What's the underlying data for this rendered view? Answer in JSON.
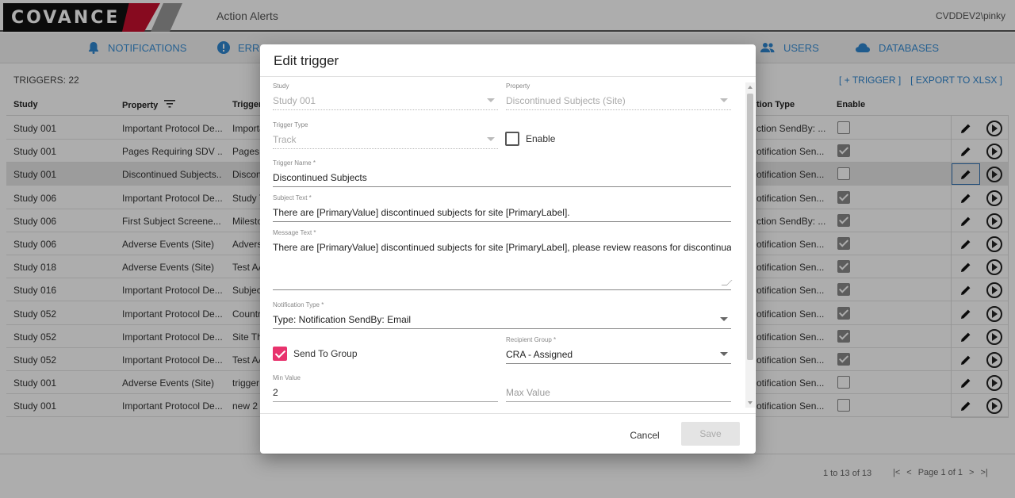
{
  "header": {
    "logo_text": "COVANCE",
    "app_title": "Action Alerts",
    "user": "CVDDEV2\\pinky"
  },
  "nav": {
    "notifications": "NOTIFICATIONS",
    "errors": "ERRC",
    "users": "USERS",
    "databases": "DATABASES"
  },
  "grid": {
    "triggers_label": "TRIGGERS: 22",
    "add_trigger": "[ + TRIGGER ]",
    "export": "[ EXPORT TO XLSX ]",
    "columns": {
      "study": "Study",
      "property": "Property",
      "trigger": "Trigger",
      "action_type": "tion Type",
      "enable": "Enable"
    },
    "rows": [
      {
        "study": "Study 001",
        "property": "Important Protocol De...",
        "trigger": "Importa",
        "action": "ction SendBy: ...",
        "enabled": false
      },
      {
        "study": "Study 001",
        "property": "Pages Requiring SDV ...",
        "trigger": "Pages",
        "action": "otification Sen...",
        "enabled": true
      },
      {
        "study": "Study 001",
        "property": "Discontinued Subjects...",
        "trigger": "Discon",
        "action": "otification Sen...",
        "enabled": false
      },
      {
        "study": "Study 006",
        "property": "Important Protocol De...",
        "trigger": "Study T",
        "action": "otification Sen...",
        "enabled": true
      },
      {
        "study": "Study 006",
        "property": "First Subject Screene...",
        "trigger": "Milesto",
        "action": "ction SendBy: ...",
        "enabled": true
      },
      {
        "study": "Study 006",
        "property": "Adverse Events (Site)",
        "trigger": "Advers",
        "action": "otification Sen...",
        "enabled": true
      },
      {
        "study": "Study 018",
        "property": "Adverse Events (Site)",
        "trigger": "Test AA",
        "action": "otification Sen...",
        "enabled": true
      },
      {
        "study": "Study 016",
        "property": "Important Protocol De...",
        "trigger": "Subjec",
        "action": "otification Sen...",
        "enabled": true
      },
      {
        "study": "Study 052",
        "property": "Important Protocol De...",
        "trigger": "Country",
        "action": "otification Sen...",
        "enabled": true
      },
      {
        "study": "Study 052",
        "property": "Important Protocol De...",
        "trigger": "Site Th",
        "action": "otification Sen...",
        "enabled": true
      },
      {
        "study": "Study 052",
        "property": "Important Protocol De...",
        "trigger": "Test AA",
        "action": "otification Sen...",
        "enabled": true
      },
      {
        "study": "Study 001",
        "property": "Adverse Events (Site)",
        "trigger": "trigger",
        "action": "otification Sen...",
        "enabled": false
      },
      {
        "study": "Study 001",
        "property": "Important Protocol De...",
        "trigger": "new 2",
        "action": "otification Sen...",
        "enabled": false
      }
    ],
    "selected_row": 2
  },
  "pager": {
    "count": "1 to 13 of 13",
    "page": "Page 1 of 1"
  },
  "dialog": {
    "title": "Edit trigger",
    "study": {
      "label": "Study",
      "value": "Study 001"
    },
    "property": {
      "label": "Property",
      "value": "Discontinued Subjects (Site)"
    },
    "trigger_type": {
      "label": "Trigger Type",
      "value": "Track"
    },
    "enable": {
      "label": "Enable",
      "checked": false
    },
    "trigger_name": {
      "label": "Trigger Name *",
      "value": "Discontinued Subjects"
    },
    "subject_text": {
      "label": "Subject Text *",
      "value": "There are [PrimaryValue] discontinued subjects for site [PrimaryLabel]."
    },
    "message_text": {
      "label": "Message Text *",
      "value": "There are [PrimaryValue] discontinued subjects for site [PrimaryLabel], please review reasons for discontinuation."
    },
    "notification_type": {
      "label": "Notification Type *",
      "value": "Type: Notification SendBy: Email"
    },
    "send_to_group": {
      "label": "Send To Group",
      "checked": true
    },
    "recipient_group": {
      "label": "Recipient Group *",
      "value": "CRA - Assigned"
    },
    "min_value": {
      "label": "Min Value",
      "value": "2"
    },
    "max_value": {
      "placeholder": "Max Value"
    },
    "cancel": "Cancel",
    "save": "Save"
  },
  "colors": {
    "accent_blue": "#2f86d0",
    "checkbox_pink": "#e8336d",
    "brand_red": "#c8102e"
  }
}
